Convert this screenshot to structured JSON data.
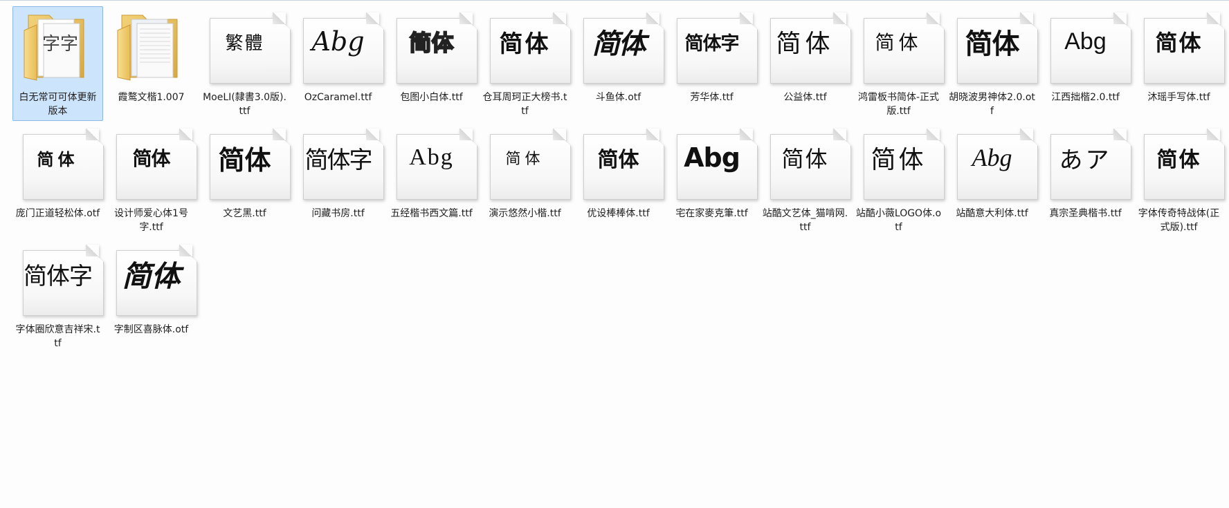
{
  "window": {
    "view": "Large Icons",
    "accent_selected": "#cde5fc"
  },
  "items": [
    {
      "name": "白无常可可体更新版本",
      "kind": "folder",
      "selected": true,
      "preview": "字字",
      "style": "folderA"
    },
    {
      "name": "霞鹜文楷1.007",
      "kind": "folder",
      "selected": false,
      "preview": "",
      "style": "folderB"
    },
    {
      "name": "MoeLI(隸書3.0版).ttf",
      "kind": "font",
      "selected": false,
      "preview": "繁體",
      "style": "s1"
    },
    {
      "name": "OzCaramel.ttf",
      "kind": "font",
      "selected": false,
      "preview": "Abg",
      "style": "s2"
    },
    {
      "name": "包图小白体.ttf",
      "kind": "font",
      "selected": false,
      "preview": "简体",
      "style": "s3"
    },
    {
      "name": "仓耳周珂正大榜书.ttf",
      "kind": "font",
      "selected": false,
      "preview": "简体",
      "style": "s4"
    },
    {
      "name": "斗鱼体.otf",
      "kind": "font",
      "selected": false,
      "preview": "简体",
      "style": "s5"
    },
    {
      "name": "芳华体.ttf",
      "kind": "font",
      "selected": false,
      "preview": "简体字",
      "style": "s6"
    },
    {
      "name": "公益体.ttf",
      "kind": "font",
      "selected": false,
      "preview": "简体",
      "style": "s7"
    },
    {
      "name": "鸿雷板书简体-正式版.ttf",
      "kind": "font",
      "selected": false,
      "preview": "简体",
      "style": "s8"
    },
    {
      "name": "胡晓波男神体2.0.otf",
      "kind": "font",
      "selected": false,
      "preview": "简体",
      "style": "s9"
    },
    {
      "name": "江西拙楷2.0.ttf",
      "kind": "font",
      "selected": false,
      "preview": "Abg",
      "style": "s10"
    },
    {
      "name": "沐瑶手写体.ttf",
      "kind": "font",
      "selected": false,
      "preview": "简体",
      "style": "s11"
    },
    {
      "name": "庞门正道轻松体.otf",
      "kind": "font",
      "selected": false,
      "preview": "简体",
      "style": "s12"
    },
    {
      "name": "设计师爱心体1号字.ttf",
      "kind": "font",
      "selected": false,
      "preview": "简体",
      "style": "s13"
    },
    {
      "name": "文艺黑.ttf",
      "kind": "font",
      "selected": false,
      "preview": "简体",
      "style": "s14"
    },
    {
      "name": "问藏书房.ttf",
      "kind": "font",
      "selected": false,
      "preview": "简体字",
      "style": "s15"
    },
    {
      "name": "五经楷书西文篇.ttf",
      "kind": "font",
      "selected": false,
      "preview": "Abg",
      "style": "s16"
    },
    {
      "name": "演示悠然小楷.ttf",
      "kind": "font",
      "selected": false,
      "preview": "简体",
      "style": "s17"
    },
    {
      "name": "优设棒棒体.ttf",
      "kind": "font",
      "selected": false,
      "preview": "简体",
      "style": "s18"
    },
    {
      "name": "宅在家麥克筆.ttf",
      "kind": "font",
      "selected": false,
      "preview": "Abg",
      "style": "s19"
    },
    {
      "name": "站酷文艺体_猫啃网.ttf",
      "kind": "font",
      "selected": false,
      "preview": "简体",
      "style": "s20"
    },
    {
      "name": "站酷小薇LOGO体.otf",
      "kind": "font",
      "selected": false,
      "preview": "简体",
      "style": "s21"
    },
    {
      "name": "站酷意大利体.ttf",
      "kind": "font",
      "selected": false,
      "preview": "Abg",
      "style": "s22"
    },
    {
      "name": "真宗圣典楷书.ttf",
      "kind": "font",
      "selected": false,
      "preview": "あア",
      "style": "s23"
    },
    {
      "name": "字体传奇特战体(正式版).ttf",
      "kind": "font",
      "selected": false,
      "preview": "简体",
      "style": "s24"
    },
    {
      "name": "字体圈欣意吉祥宋.ttf",
      "kind": "font",
      "selected": false,
      "preview": "简体字",
      "style": "s25"
    },
    {
      "name": "字制区喜脉体.otf",
      "kind": "font",
      "selected": false,
      "preview": "简体",
      "style": "s26"
    }
  ]
}
